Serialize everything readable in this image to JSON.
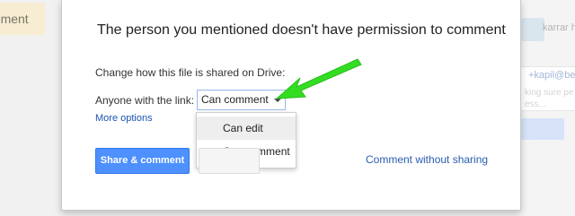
{
  "background": {
    "left_doc_chip": "ocument",
    "right_panel": {
      "name": "karrar h",
      "mention": "+kapil@be",
      "faded_line_1": "king sure pe",
      "faded_line_2": "ess..."
    }
  },
  "dialog": {
    "title": "The person you mentioned doesn't have permission to comment",
    "change_text": "Change how this file is shared on Drive:",
    "link_label": "Anyone with the link:",
    "select_value": "Can comment",
    "more_options": "More options",
    "dropdown": {
      "options": [
        {
          "label": "Can edit",
          "checked": false,
          "hovered": true
        },
        {
          "label": "Can comment",
          "checked": true,
          "hovered": false
        }
      ],
      "check_glyph": "✓"
    },
    "share_button": "Share & comment",
    "comment_without_sharing": "Comment without sharing"
  },
  "colors": {
    "primary_button": "#4d90fe",
    "link": "#2a5db0",
    "annotation_arrow": "#33dd22"
  },
  "icons": {
    "dropdown_caret": "chevron-down-icon",
    "checkmark": "checkmark-icon",
    "annotation": "arrow-pointer-icon"
  }
}
